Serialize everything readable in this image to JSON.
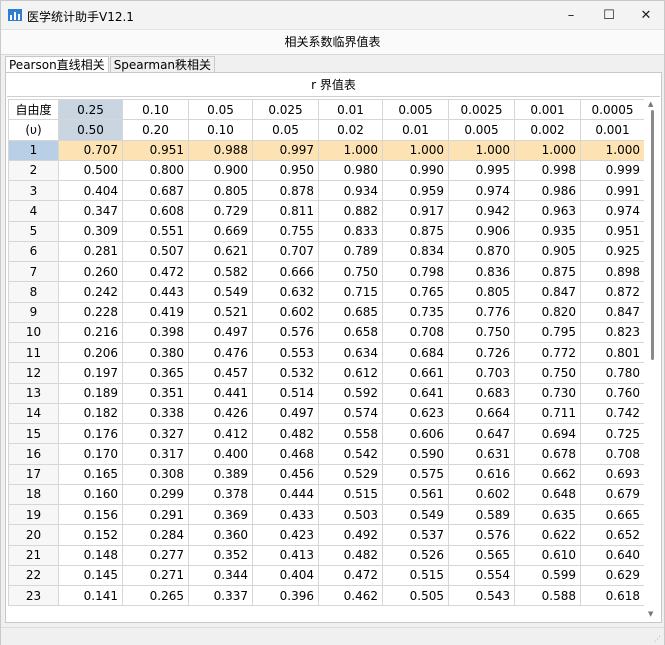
{
  "window": {
    "title": "医学统计助手V12.1",
    "controls": {
      "minimize": "–",
      "maximize": "☐",
      "close": "✕"
    }
  },
  "header_label": "相关系数临界值表",
  "tabs": [
    {
      "label": "Pearson直线相关",
      "active": true
    },
    {
      "label": "Spearman秩相关",
      "active": false
    }
  ],
  "table": {
    "title": "r 界值表",
    "header_row1": [
      "自由度",
      "0.25",
      "0.10",
      "0.05",
      "0.025",
      "0.01",
      "0.005",
      "0.0025",
      "0.001",
      "0.0005"
    ],
    "header_row2": [
      "(υ)",
      "0.50",
      "0.20",
      "0.10",
      "0.05",
      "0.02",
      "0.01",
      "0.005",
      "0.002",
      "0.001"
    ],
    "rows": [
      [
        "1",
        "0.707",
        "0.951",
        "0.988",
        "0.997",
        "1.000",
        "1.000",
        "1.000",
        "1.000",
        "1.000"
      ],
      [
        "2",
        "0.500",
        "0.800",
        "0.900",
        "0.950",
        "0.980",
        "0.990",
        "0.995",
        "0.998",
        "0.999"
      ],
      [
        "3",
        "0.404",
        "0.687",
        "0.805",
        "0.878",
        "0.934",
        "0.959",
        "0.974",
        "0.986",
        "0.991"
      ],
      [
        "4",
        "0.347",
        "0.608",
        "0.729",
        "0.811",
        "0.882",
        "0.917",
        "0.942",
        "0.963",
        "0.974"
      ],
      [
        "5",
        "0.309",
        "0.551",
        "0.669",
        "0.755",
        "0.833",
        "0.875",
        "0.906",
        "0.935",
        "0.951"
      ],
      [
        "6",
        "0.281",
        "0.507",
        "0.621",
        "0.707",
        "0.789",
        "0.834",
        "0.870",
        "0.905",
        "0.925"
      ],
      [
        "7",
        "0.260",
        "0.472",
        "0.582",
        "0.666",
        "0.750",
        "0.798",
        "0.836",
        "0.875",
        "0.898"
      ],
      [
        "8",
        "0.242",
        "0.443",
        "0.549",
        "0.632",
        "0.715",
        "0.765",
        "0.805",
        "0.847",
        "0.872"
      ],
      [
        "9",
        "0.228",
        "0.419",
        "0.521",
        "0.602",
        "0.685",
        "0.735",
        "0.776",
        "0.820",
        "0.847"
      ],
      [
        "10",
        "0.216",
        "0.398",
        "0.497",
        "0.576",
        "0.658",
        "0.708",
        "0.750",
        "0.795",
        "0.823"
      ],
      [
        "11",
        "0.206",
        "0.380",
        "0.476",
        "0.553",
        "0.634",
        "0.684",
        "0.726",
        "0.772",
        "0.801"
      ],
      [
        "12",
        "0.197",
        "0.365",
        "0.457",
        "0.532",
        "0.612",
        "0.661",
        "0.703",
        "0.750",
        "0.780"
      ],
      [
        "13",
        "0.189",
        "0.351",
        "0.441",
        "0.514",
        "0.592",
        "0.641",
        "0.683",
        "0.730",
        "0.760"
      ],
      [
        "14",
        "0.182",
        "0.338",
        "0.426",
        "0.497",
        "0.574",
        "0.623",
        "0.664",
        "0.711",
        "0.742"
      ],
      [
        "15",
        "0.176",
        "0.327",
        "0.412",
        "0.482",
        "0.558",
        "0.606",
        "0.647",
        "0.694",
        "0.725"
      ],
      [
        "16",
        "0.170",
        "0.317",
        "0.400",
        "0.468",
        "0.542",
        "0.590",
        "0.631",
        "0.678",
        "0.708"
      ],
      [
        "17",
        "0.165",
        "0.308",
        "0.389",
        "0.456",
        "0.529",
        "0.575",
        "0.616",
        "0.662",
        "0.693"
      ],
      [
        "18",
        "0.160",
        "0.299",
        "0.378",
        "0.444",
        "0.515",
        "0.561",
        "0.602",
        "0.648",
        "0.679"
      ],
      [
        "19",
        "0.156",
        "0.291",
        "0.369",
        "0.433",
        "0.503",
        "0.549",
        "0.589",
        "0.635",
        "0.665"
      ],
      [
        "20",
        "0.152",
        "0.284",
        "0.360",
        "0.423",
        "0.492",
        "0.537",
        "0.576",
        "0.622",
        "0.652"
      ],
      [
        "21",
        "0.148",
        "0.277",
        "0.352",
        "0.413",
        "0.482",
        "0.526",
        "0.565",
        "0.610",
        "0.640"
      ],
      [
        "22",
        "0.145",
        "0.271",
        "0.344",
        "0.404",
        "0.472",
        "0.515",
        "0.554",
        "0.599",
        "0.629"
      ],
      [
        "23",
        "0.141",
        "0.265",
        "0.337",
        "0.396",
        "0.462",
        "0.505",
        "0.543",
        "0.588",
        "0.618"
      ]
    ],
    "highlight_row_index": 0,
    "selected_column_index": 1
  },
  "colors": {
    "highlight_row": "#fde3b4",
    "selected_header": "#c9d6e2",
    "selected_row_header": "#b9cfe6"
  },
  "icons": {
    "app": "bar-chart-icon",
    "scroll_up": "▲",
    "scroll_down": "▼",
    "grip": "⋰"
  }
}
